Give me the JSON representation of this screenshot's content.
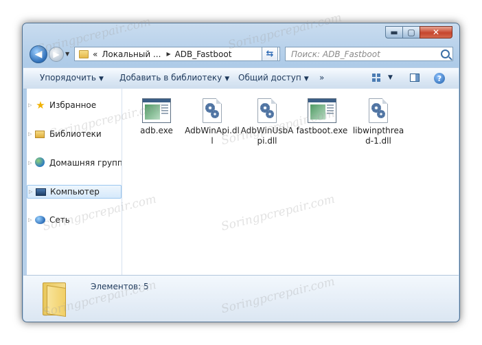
{
  "titlebar": {
    "minimize_label": "▬",
    "maximize_label": "▢",
    "close_label": "✕"
  },
  "address": {
    "chevron": "«",
    "crumbs": [
      "Локальный ...",
      "ADB_Fastboot"
    ],
    "separator": "▶",
    "dropdown": "▼"
  },
  "search": {
    "placeholder": "Поиск: ADB_Fastboot"
  },
  "toolbar": {
    "organize": "Упорядочить",
    "add_to_library": "Добавить в библиотеку",
    "share": "Общий доступ",
    "more": "»",
    "dropdown_arrow": "▼",
    "help": "?"
  },
  "sidebar": {
    "items": [
      {
        "label": "Избранное",
        "icon": "star-icon"
      },
      {
        "label": "Библиотеки",
        "icon": "libraries-icon"
      },
      {
        "label": "Домашняя групп",
        "icon": "homegroup-icon"
      },
      {
        "label": "Компьютер",
        "icon": "computer-icon",
        "selected": true
      },
      {
        "label": "Сеть",
        "icon": "network-icon"
      }
    ],
    "expander": "▷"
  },
  "files": [
    {
      "name": "adb.exe",
      "type": "exe"
    },
    {
      "name": "AdbWinApi.dll",
      "type": "dll"
    },
    {
      "name": "AdbWinUsbApi.dll",
      "type": "dll"
    },
    {
      "name": "fastboot.exe",
      "type": "exe"
    },
    {
      "name": "libwinpthread-1.dll",
      "type": "dll"
    }
  ],
  "status": {
    "items_count": "Элементов: 5"
  },
  "watermark": "Soringpcrepair.com",
  "colors": {
    "window_frame": "#aecbe8",
    "selected": "#d6e9fb",
    "close": "#c6452d"
  }
}
